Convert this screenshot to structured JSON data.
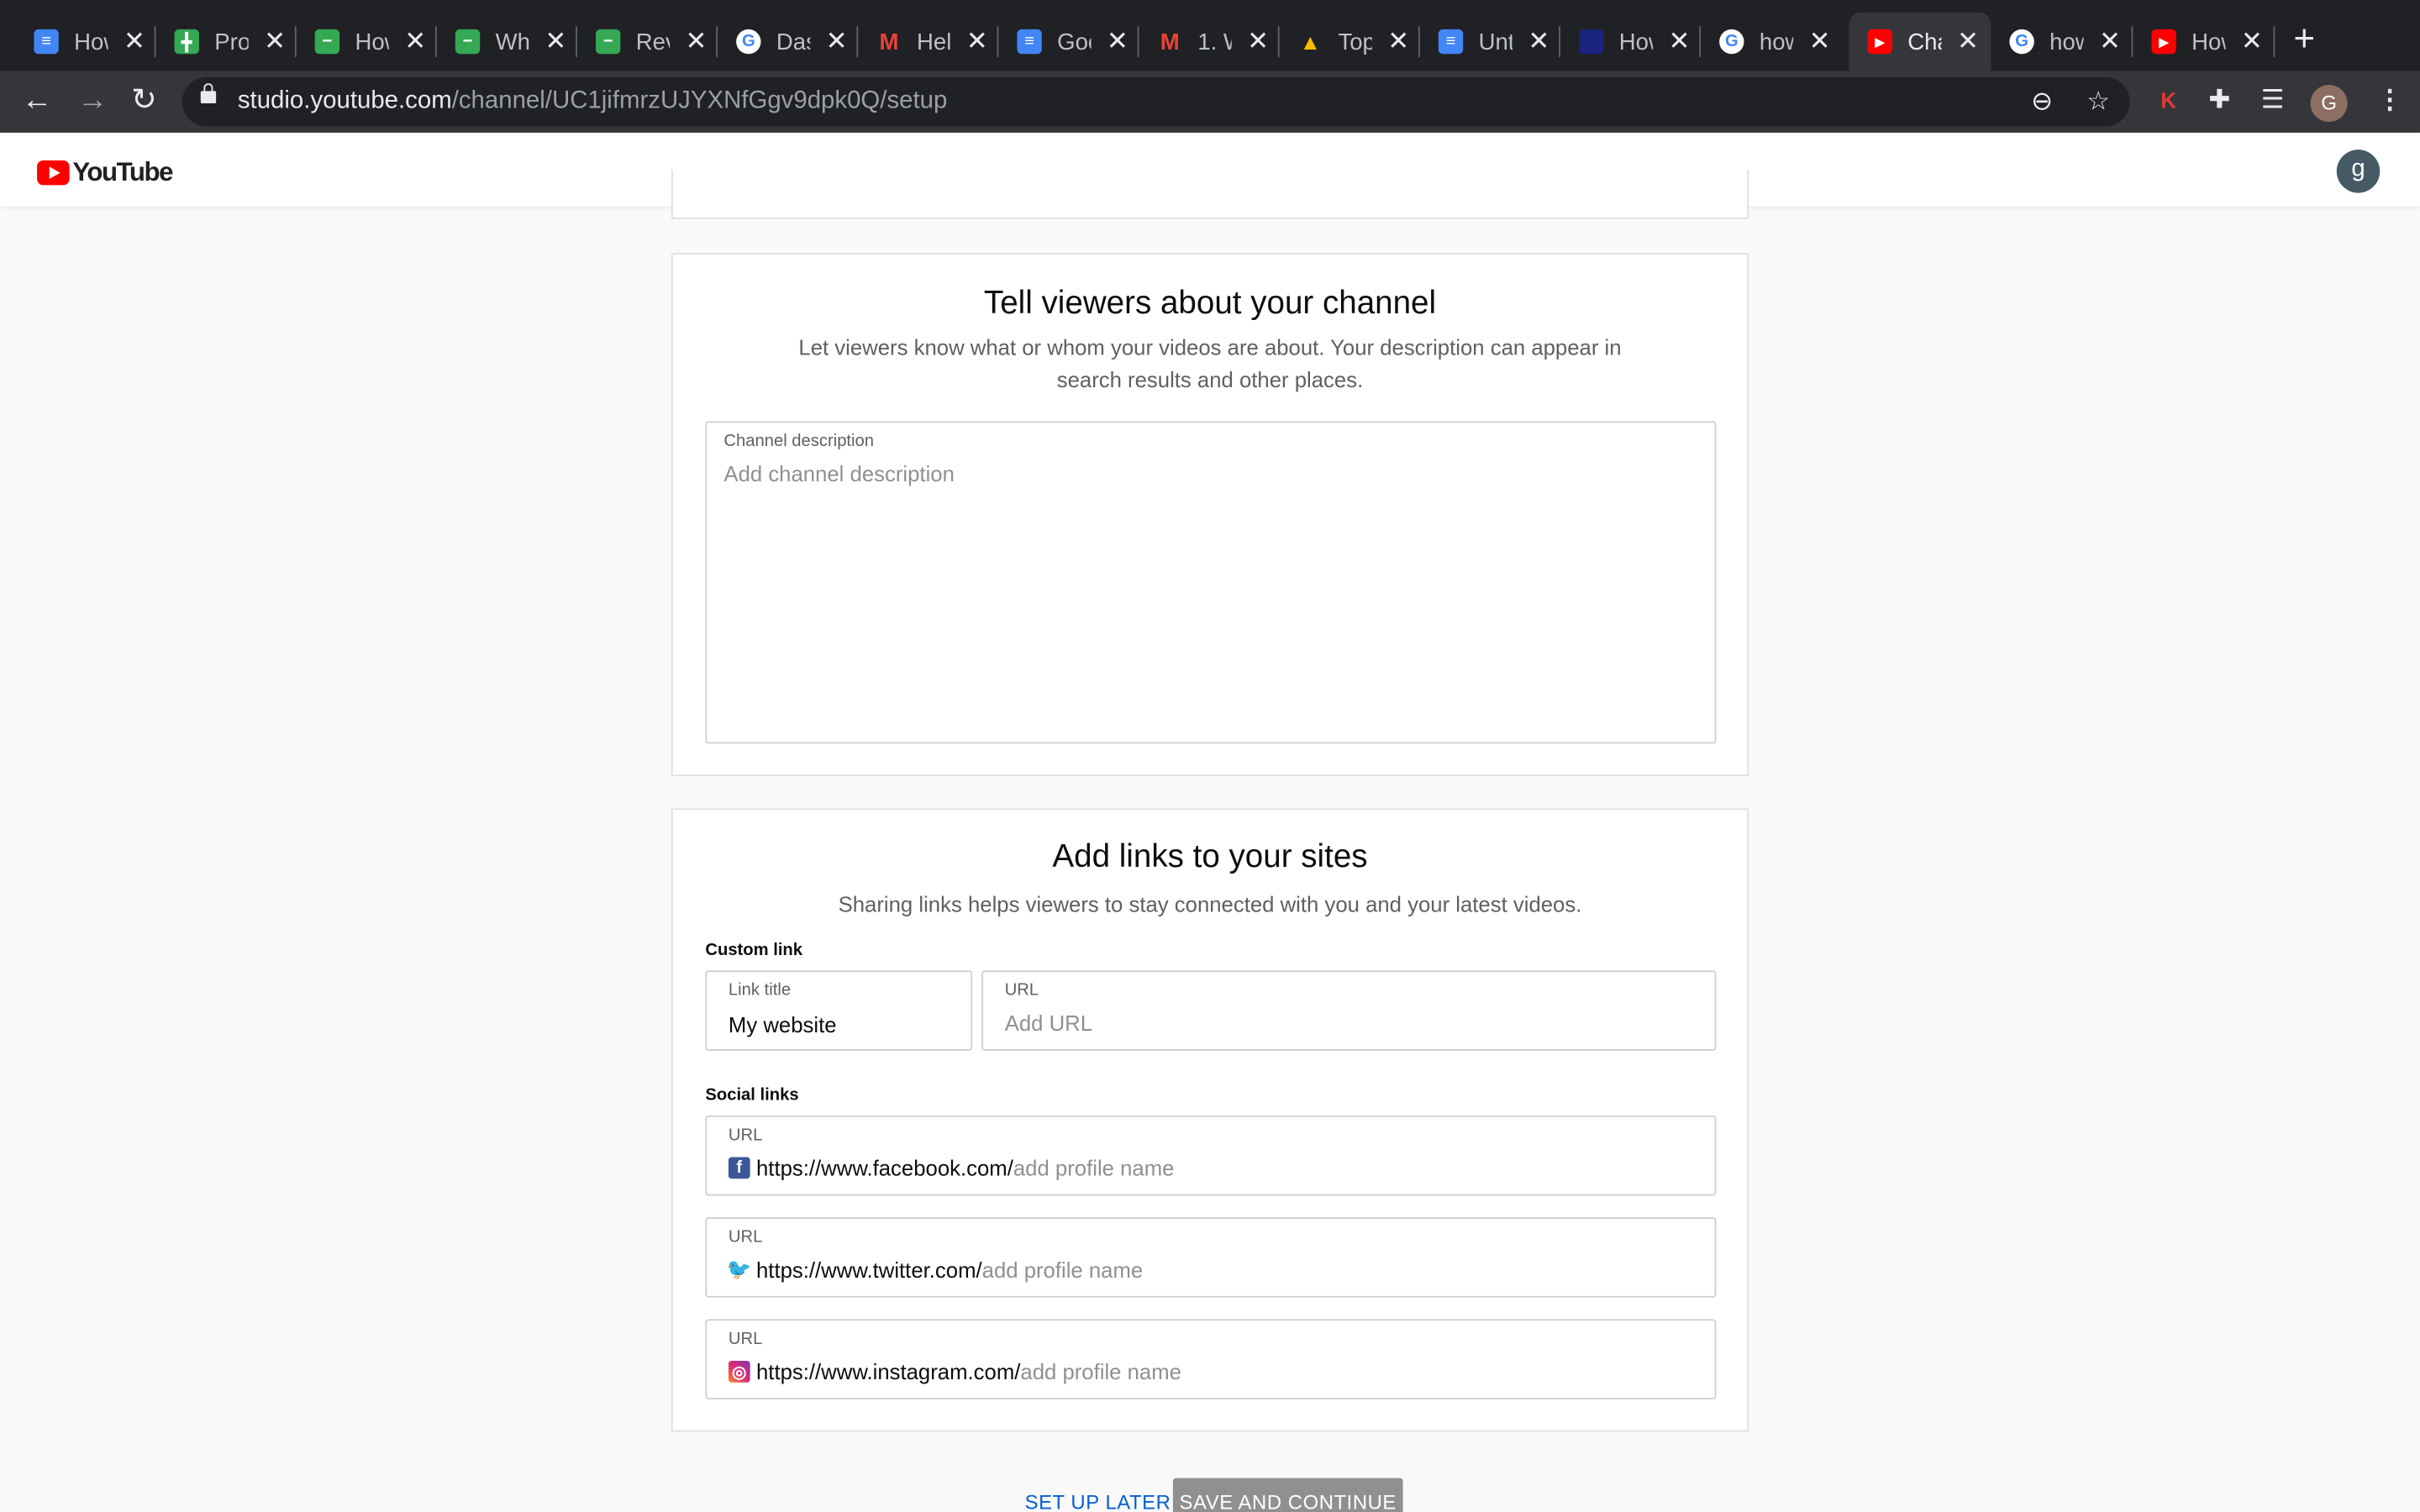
{
  "browser": {
    "tabs": [
      {
        "label": "How",
        "icon": "docs-icon",
        "color": "#4285f4"
      },
      {
        "label": "Pro",
        "icon": "sheets-icon",
        "color": "#34a853"
      },
      {
        "label": "How",
        "icon": "sheets-icon",
        "color": "#34a853"
      },
      {
        "label": "Wh",
        "icon": "sheets-icon",
        "color": "#34a853"
      },
      {
        "label": "Rev",
        "icon": "sheets-icon",
        "color": "#34a853"
      },
      {
        "label": "Das",
        "icon": "google-icon",
        "color": "#ffffff"
      },
      {
        "label": "Hel",
        "icon": "gmail-icon",
        "color": "#ea4335"
      },
      {
        "label": "Goo",
        "icon": "docs-icon",
        "color": "#4285f4"
      },
      {
        "label": "1. W",
        "icon": "gmail-icon",
        "color": "#ea4335"
      },
      {
        "label": "Top",
        "icon": "drive-icon",
        "color": "#fbbc04"
      },
      {
        "label": "Unt",
        "icon": "docs-icon",
        "color": "#4285f4"
      },
      {
        "label": "How",
        "icon": "site-icon",
        "color": "#1a237e"
      },
      {
        "label": "how",
        "icon": "google-icon",
        "color": "#ffffff"
      },
      {
        "label": "Cha",
        "icon": "youtube-icon",
        "color": "#ff0000",
        "active": true
      },
      {
        "label": "how",
        "icon": "google-icon",
        "color": "#ffffff"
      },
      {
        "label": "How",
        "icon": "youtube-icon",
        "color": "#ff0000"
      }
    ],
    "close_glyph": "✕",
    "new_tab_glyph": "+",
    "url_host": "studio.youtube.com",
    "url_path": "/channel/UC1jifmrzUJYXNfGgv9dpk0Q/setup",
    "profile_initial": "G",
    "extension_initial": "K"
  },
  "header": {
    "logo_text": "YouTube",
    "avatar_initial": "g"
  },
  "description_card": {
    "title": "Tell viewers about your channel",
    "subtitle": "Let viewers know what or whom your videos are about. Your description can appear in search results and other places.",
    "field_label": "Channel description",
    "field_placeholder": "Add channel description"
  },
  "links_card": {
    "title": "Add links to your sites",
    "subtitle": "Sharing links helps viewers to stay connected with you and your latest videos.",
    "custom_link_label": "Custom link",
    "link_title_label": "Link title",
    "link_title_value": "My website",
    "url_label": "URL",
    "url_placeholder": "Add URL",
    "social_links_label": "Social links",
    "social": [
      {
        "label": "URL",
        "base": "https://www.facebook.com/",
        "placeholder": "add profile name",
        "icon": "facebook-icon"
      },
      {
        "label": "URL",
        "base": "https://www.twitter.com/",
        "placeholder": "add profile name",
        "icon": "twitter-icon"
      },
      {
        "label": "URL",
        "base": "https://www.instagram.com/",
        "placeholder": "add profile name",
        "icon": "instagram-icon"
      }
    ]
  },
  "actions": {
    "later_label": "SET UP LATER",
    "save_label": "SAVE AND CONTINUE"
  }
}
